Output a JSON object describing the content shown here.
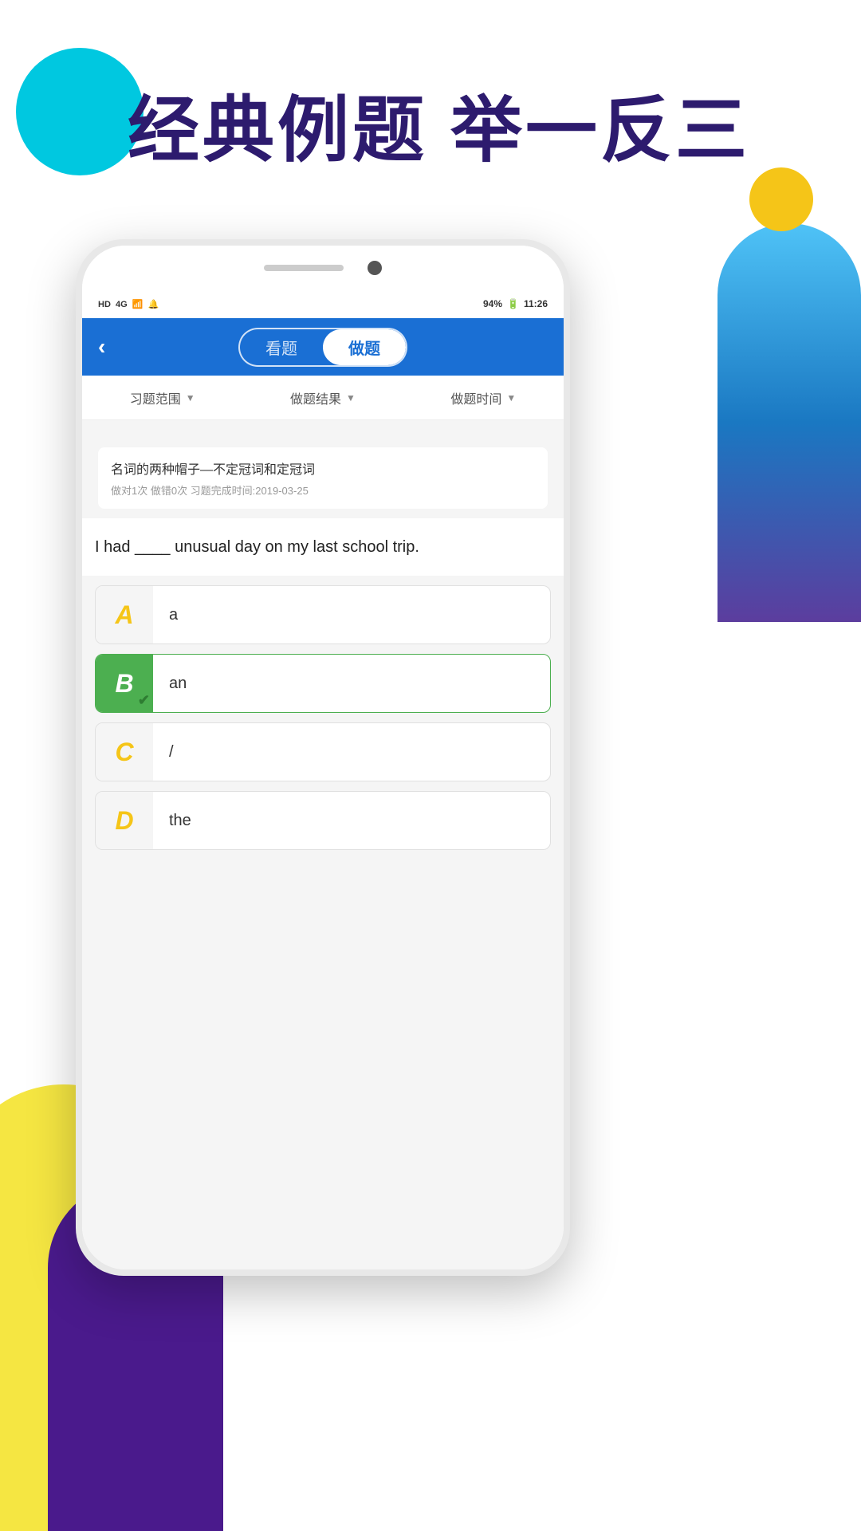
{
  "background": {
    "colors": {
      "blue_circle": "#00c8e0",
      "yellow_circle": "#f5c518",
      "yellow_shape": "#f5e642",
      "purple_shape": "#4a1a8c",
      "blue_gradient": "#4fc3f7"
    }
  },
  "header": {
    "title": "经典例题  举一反三"
  },
  "phone": {
    "status_bar": {
      "left": "HD  4G  ▲▼  ☁  ✕",
      "battery": "94%",
      "time": "11:26"
    },
    "nav": {
      "back_icon": "‹",
      "tab_view": "看题",
      "tab_do": "做题",
      "active_tab": "做题"
    },
    "filters": {
      "range_label": "习题范围",
      "result_label": "做题结果",
      "time_label": "做题时间",
      "arrow": "▼"
    },
    "category": {
      "title": "名词的两种帽子—不定冠词和定冠词",
      "meta": "做对1次  做错0次  习题完成时间:2019-03-25"
    },
    "question": {
      "text": "I had ____ unusual day on my last school trip."
    },
    "options": [
      {
        "label": "A",
        "text": "a",
        "correct": false,
        "label_style": "a"
      },
      {
        "label": "B",
        "text": "an",
        "correct": true,
        "label_style": "b"
      },
      {
        "label": "C",
        "text": "/",
        "correct": false,
        "label_style": "c"
      },
      {
        "label": "D",
        "text": "the",
        "correct": false,
        "label_style": "d"
      }
    ]
  }
}
